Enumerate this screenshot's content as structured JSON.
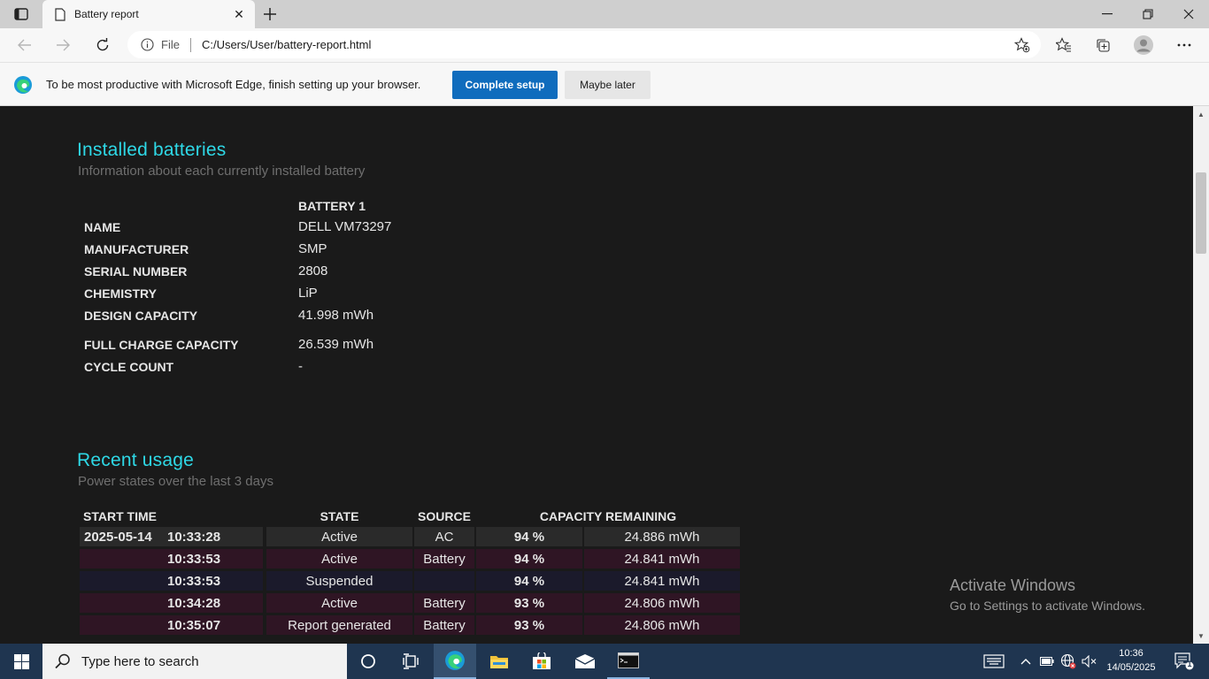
{
  "browser": {
    "tab_title": "Battery report",
    "address_scheme": "File",
    "address_url": "C:/Users/User/battery-report.html"
  },
  "infobar": {
    "message": "To be most productive with Microsoft Edge, finish setting up your browser.",
    "complete_setup": "Complete setup",
    "maybe_later": "Maybe later"
  },
  "installed": {
    "title": "Installed batteries",
    "subtitle": "Information about each currently installed battery",
    "column": "BATTERY 1",
    "rows": [
      {
        "label": "NAME",
        "value": "DELL VM73297"
      },
      {
        "label": "MANUFACTURER",
        "value": "SMP"
      },
      {
        "label": "SERIAL NUMBER",
        "value": "2808"
      },
      {
        "label": "CHEMISTRY",
        "value": "LiP"
      },
      {
        "label": "DESIGN CAPACITY",
        "value": "41.998 mWh"
      },
      {
        "label": "FULL CHARGE CAPACITY",
        "value": "26.539 mWh"
      },
      {
        "label": "CYCLE COUNT",
        "value": "-"
      }
    ]
  },
  "recent": {
    "title": "Recent usage",
    "subtitle": "Power states over the last 3 days",
    "headers": {
      "start_time": "START TIME",
      "state": "STATE",
      "source": "SOURCE",
      "capacity": "CAPACITY REMAINING"
    },
    "rows": [
      {
        "date": "2025-05-14",
        "time": "10:33:28",
        "state": "Active",
        "source": "AC",
        "percent": "94 %",
        "mwh": "24.886 mWh"
      },
      {
        "date": "",
        "time": "10:33:53",
        "state": "Active",
        "source": "Battery",
        "percent": "94 %",
        "mwh": "24.841 mWh"
      },
      {
        "date": "",
        "time": "10:33:53",
        "state": "Suspended",
        "source": "",
        "percent": "94 %",
        "mwh": "24.841 mWh"
      },
      {
        "date": "",
        "time": "10:34:28",
        "state": "Active",
        "source": "Battery",
        "percent": "93 %",
        "mwh": "24.806 mWh"
      },
      {
        "date": "",
        "time": "10:35:07",
        "state": "Report generated",
        "source": "Battery",
        "percent": "93 %",
        "mwh": "24.806 mWh"
      }
    ]
  },
  "watermark": {
    "title": "Activate Windows",
    "subtitle": "Go to Settings to activate Windows."
  },
  "taskbar": {
    "search_placeholder": "Type here to search",
    "time": "10:36",
    "date": "14/05/2025",
    "notification_count": "1"
  },
  "colors": {
    "accent_heading": "#2ed8e6",
    "primary_button": "#0f6cbd",
    "row_alt": "#2f1524",
    "taskbar": "#1f3550"
  }
}
